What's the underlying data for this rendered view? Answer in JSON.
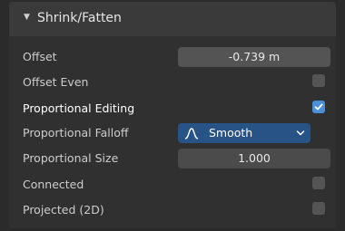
{
  "panel": {
    "title": "Shrink/Fatten",
    "expanded": true
  },
  "rows": {
    "offset": {
      "label": "Offset",
      "value": "-0.739 m"
    },
    "offset_even": {
      "label": "Offset Even",
      "checked": false
    },
    "proportional_editing": {
      "label": "Proportional Editing",
      "checked": true
    },
    "proportional_falloff": {
      "label": "Proportional Falloff",
      "value": "Smooth",
      "icon": "smooth-falloff-icon"
    },
    "proportional_size": {
      "label": "Proportional Size",
      "value": "1.000"
    },
    "connected": {
      "label": "Connected",
      "checked": false
    },
    "projected": {
      "label": "Projected (2D)",
      "checked": false
    }
  },
  "colors": {
    "panel_bg": "#303030",
    "header_bg": "#3a3a3a",
    "field_bg": "#545454",
    "dropdown_bg": "#275386",
    "checkbox_on": "#4b8fd8"
  }
}
